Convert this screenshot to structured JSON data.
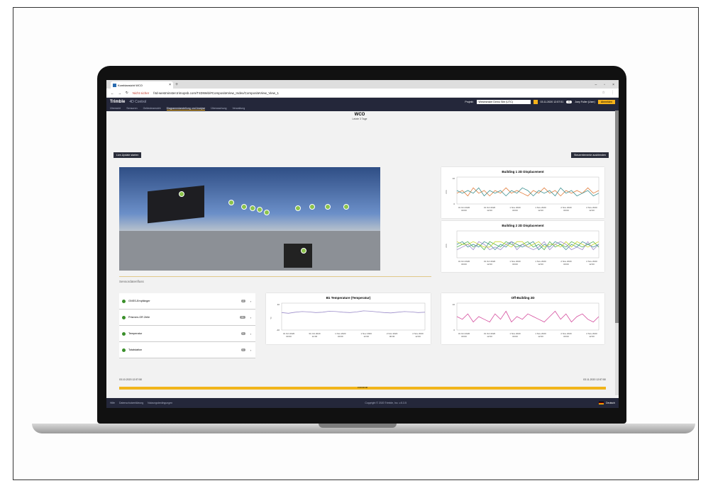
{
  "browser": {
    "tab_title": "Kombiansicht WCO",
    "close_glyph": "×",
    "new_tab_glyph": "+",
    "security_warning": "Nicht sicher",
    "url": "f4d-westminster.trimopsb.com/T4DWeb/#CompositeView_Index/CompositeView_View_1",
    "nav_back": "←",
    "nav_forward": "→",
    "nav_reload": "↻",
    "window_controls": [
      "–",
      "▫",
      "×"
    ],
    "toolbar_icons": [
      "☆",
      "⋮"
    ]
  },
  "app": {
    "brand": "Trimble",
    "product": "4D Control",
    "project_label": "Projekt:",
    "project_value": "Westminster Demo Site (UTC)",
    "datetime": "03.11.2020 12:57:51",
    "count_badge": "0",
    "user": "Joey Fuller (User)",
    "logout": "Abmelden"
  },
  "nav": {
    "items": [
      "Übersicht",
      "Sensoren",
      "Geländeansicht",
      "Diagrammdarstellung und Analyse",
      "Überwachung",
      "Verwaltung"
    ],
    "active": "Diagrammdarstellung und Analyse"
  },
  "page": {
    "title": "WCO",
    "subtitle": "Letzte 3 Tage",
    "live_update_button": "Live-Update starten",
    "hide_controls_button": "Steuerelemente ausblenden"
  },
  "sensors": {
    "header": "Sensordatenfluss",
    "items": [
      {
        "label": "GNSS-Empfänger",
        "count": "2"
      },
      {
        "label": "Prismen-GR Zeile",
        "count": "11"
      },
      {
        "label": "Temperatur",
        "count": "1"
      },
      {
        "label": "Totalstation",
        "count": "1"
      }
    ],
    "chevron": "›"
  },
  "charts": {
    "b1": {
      "title": "Building 1 2D Displacement",
      "ylabel": "mm",
      "ytop": "10",
      "ybottom": "0"
    },
    "b2": {
      "title": "Building 2 2D Displacement",
      "ylabel": "mm"
    },
    "temp": {
      "title": "B1 Temperature (Temperatur)",
      "ytop": "40",
      "ybottom": "-40",
      "ylabel": "°C"
    },
    "off": {
      "title": "Off-Building 2D",
      "ytop": "10",
      "ybottom": "0"
    },
    "xticks": [
      "31 Oct 2020 00:00",
      "31 Oct 2020 12:00",
      "1 Nov 2020 00:00",
      "1 Nov 2020 12:00",
      "2 Nov 2020 00:00",
      "2 Nov 2020 12:00"
    ],
    "colors": {
      "orange": "#e07b39",
      "teal": "#3b8f8f",
      "green": "#4caf50",
      "lime": "#c7d82b",
      "purple": "#9b8cc9",
      "magenta": "#d44a9c"
    }
  },
  "chart_data": [
    {
      "type": "line",
      "title": "Building 1 2D Displacement",
      "series": [
        {
          "values": [
            4,
            5,
            3,
            6,
            4,
            5,
            3,
            5,
            4,
            6,
            4,
            5,
            4,
            3,
            5,
            4,
            6,
            4,
            5,
            3,
            5,
            4,
            5,
            4,
            6,
            4,
            5
          ]
        },
        {
          "values": [
            5,
            4,
            5,
            4,
            6,
            3,
            5,
            4,
            5,
            3,
            5,
            4,
            6,
            5,
            3,
            5,
            4,
            5,
            3,
            6,
            4,
            5,
            3,
            4,
            5,
            3,
            4
          ]
        }
      ]
    },
    {
      "type": "line",
      "title": "Building 2 2D Displacement",
      "series": [
        {
          "values": [
            4,
            5,
            6,
            4,
            5,
            3,
            6,
            5,
            4,
            6,
            5,
            4,
            5,
            6,
            4,
            5,
            3,
            6,
            4,
            5,
            4,
            6,
            5,
            4,
            5,
            6,
            4
          ]
        },
        {
          "values": [
            5,
            6,
            4,
            5,
            4,
            6,
            5,
            3,
            5,
            4,
            6,
            5,
            4,
            5,
            6,
            3,
            5,
            4,
            6,
            5,
            3,
            5,
            4,
            6,
            5,
            4,
            5
          ]
        },
        {
          "values": [
            6,
            5,
            5,
            6,
            5,
            4,
            4,
            6,
            6,
            5,
            4,
            6,
            6,
            4,
            5,
            6,
            4,
            5,
            5,
            4,
            6,
            4,
            6,
            5,
            4,
            5,
            6
          ]
        },
        {
          "values": [
            3,
            4,
            5,
            3,
            6,
            5,
            3,
            4,
            3,
            5,
            6,
            3,
            5,
            4,
            3,
            4,
            6,
            3,
            5,
            6,
            5,
            3,
            4,
            3,
            6,
            3,
            5
          ]
        }
      ]
    },
    {
      "type": "line",
      "title": "B1 Temperature (Temperatur)",
      "series": [
        {
          "values": [
            12,
            10,
            13,
            15,
            14,
            12,
            13,
            16,
            15,
            13,
            12,
            14,
            17,
            16,
            14,
            12,
            11,
            13,
            15,
            14,
            12,
            13
          ]
        }
      ]
    },
    {
      "type": "line",
      "title": "Off-Building 2D",
      "series": [
        {
          "values": [
            5,
            4,
            6,
            3,
            5,
            4,
            3,
            6,
            4,
            7,
            3,
            5,
            4,
            6,
            5,
            4,
            3,
            5,
            7,
            4,
            6,
            3,
            5,
            6,
            4,
            3,
            5
          ]
        }
      ]
    }
  ],
  "timeline": {
    "start": "03.10.2020 12:57:50",
    "end": "03.11.2020 12:57:50",
    "center": "3 00:00:00"
  },
  "footer": {
    "help": "Hilfe",
    "privacy": "Datenschutzerklärung",
    "terms": "Nutzungsbedingungen",
    "copyright": "Copyright © 2020 Trimble, Inc. v.5.3.5",
    "language": "Deutsch"
  }
}
